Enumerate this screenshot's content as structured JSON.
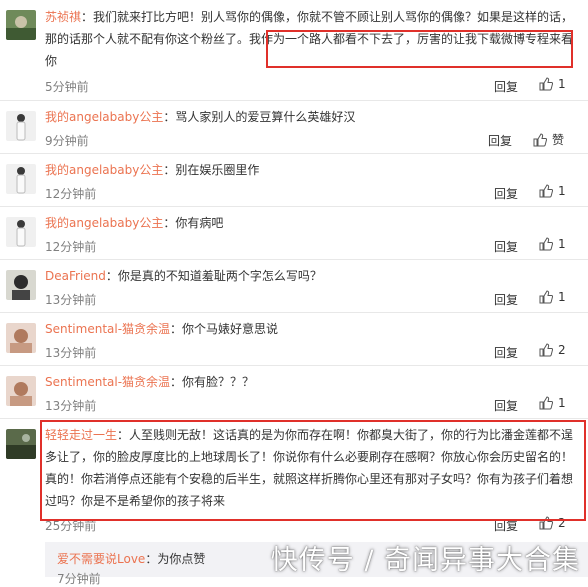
{
  "comments": [
    {
      "user": "苏祯祺",
      "text": "：我们就来打比方吧！别人骂你的偶像，你就不管不顾让别人骂你的偶像？如果是这样的话，那的话那个人就不配有你这个粉丝了。我作为一个路人都看不下去了，厉害的让我下载微博专程来看你",
      "time": "5分钟前",
      "reply": "回复",
      "likes": "1"
    },
    {
      "user": "我的angelababy公主",
      "text": "：骂人家别人的爱豆算什么英雄好汉",
      "time": "9分钟前",
      "reply": "回复",
      "likes": "赞"
    },
    {
      "user": "我的angelababy公主",
      "text": "：别在娱乐圈里作",
      "time": "12分钟前",
      "reply": "回复",
      "likes": "1"
    },
    {
      "user": "我的angelababy公主",
      "text": "：你有病吧",
      "time": "12分钟前",
      "reply": "回复",
      "likes": "1"
    },
    {
      "user": "DeaFriend",
      "text": "：你是真的不知道羞耻两个字怎么写吗？",
      "time": "13分钟前",
      "reply": "回复",
      "likes": "1"
    },
    {
      "user": "Sentimental-猫贪余温",
      "text": "：你个马婊好意思说",
      "time": "13分钟前",
      "reply": "回复",
      "likes": "2"
    },
    {
      "user": "Sentimental-猫贪余温",
      "text": "：你有脸？？？",
      "time": "13分钟前",
      "reply": "回复",
      "likes": "1"
    },
    {
      "user": "轻轻走过一生",
      "text": "：人至贱则无敌！这话真的是为你而存在啊！你都臭大街了，你的行为比潘金莲都不逞多让了，你的脸皮厚度比的上地球周长了！你说你有什么必要刷存在感啊？你放心你会历史留名的！真的！你若消停点还能有个安稳的后半生，就照这样折腾你心里还有那对子女吗？你有为孩子们着想过吗？你是不是希望你的孩子将来",
      "time": "25分钟前",
      "reply": "回复",
      "likes": "2"
    }
  ],
  "sub_reply": {
    "user": "爱不需要说Love",
    "text": "：为你点赞",
    "time": "7分钟前"
  },
  "watermark": "快传号 / 奇闻异事大合集",
  "colors": {
    "username": "#eb7350",
    "highlight": "#e0302a",
    "meta": "#808080"
  }
}
